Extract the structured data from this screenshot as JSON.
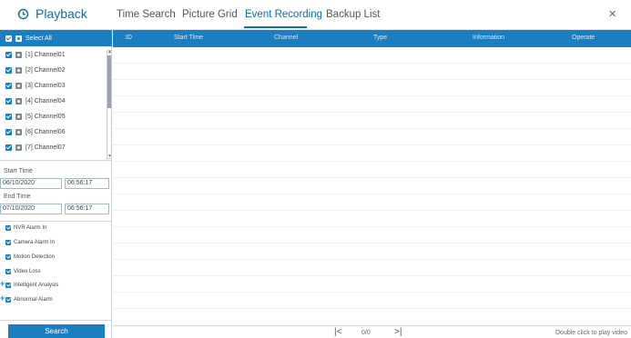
{
  "header": {
    "title": "Playback",
    "tabs": [
      {
        "label": "Time Search",
        "active": false
      },
      {
        "label": "Picture Grid",
        "active": false
      },
      {
        "label": "Event Recording",
        "active": true
      },
      {
        "label": "Backup List",
        "active": false
      }
    ],
    "close_label": "×"
  },
  "sidebar": {
    "select_all": "Select All",
    "channels": [
      "[1] Channel01",
      "[2] Channel02",
      "[3] Channel03",
      "[4] Channel04",
      "[5] Channel05",
      "[6] Channel06",
      "[7] Channel07"
    ],
    "start_time": {
      "label": "Start Time",
      "date": "06/10/2020",
      "time": "06:56:17"
    },
    "end_time": {
      "label": "End Time",
      "date": "07/10/2020",
      "time": "06:56:17"
    },
    "alarm_types": [
      {
        "label": "NVR Alarm In",
        "expandable": false
      },
      {
        "label": "Camera Alarm In",
        "expandable": false
      },
      {
        "label": "Motion Detection",
        "expandable": false
      },
      {
        "label": "Video Loss",
        "expandable": false
      },
      {
        "label": "Intelligent Analysis",
        "expandable": true
      },
      {
        "label": "Abnormal Alarm",
        "expandable": true
      }
    ],
    "search_label": "Search"
  },
  "table": {
    "columns": [
      "ID",
      "Start Time",
      "Channel",
      "Type",
      "Information",
      "Operate"
    ],
    "rows": []
  },
  "footer": {
    "page_info": "0/0",
    "first_page_icon": "first-page-icon",
    "last_page_icon": "last-page-icon",
    "hint": "Double click to play video"
  },
  "colors": {
    "accent": "#1b7ec1",
    "brand": "#0b6ea8"
  }
}
